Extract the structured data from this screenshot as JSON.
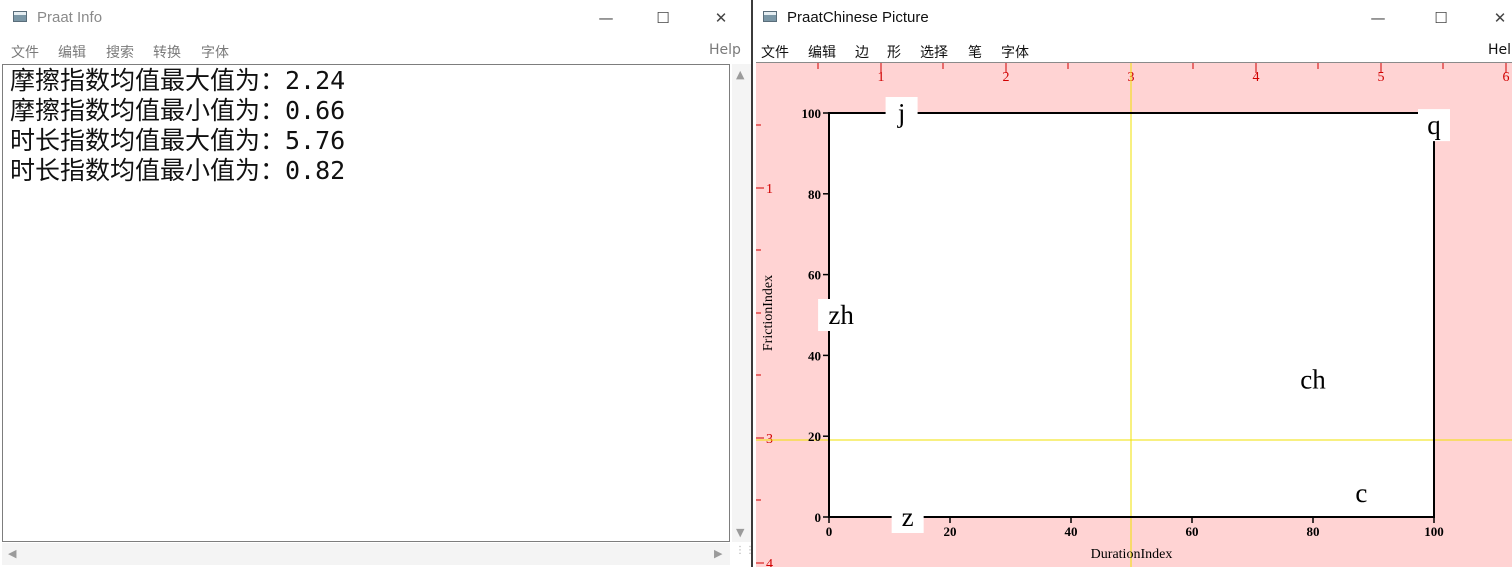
{
  "info_window": {
    "title": "Praat Info",
    "menu": [
      "文件",
      "编辑",
      "搜索",
      "转换",
      "字体"
    ],
    "help": "Help",
    "lines": [
      "摩擦指数均值最大值为：2.24",
      "摩擦指数均值最小值为：0.66",
      "时长指数均值最大值为：5.76",
      "时长指数均值最小值为：0.82"
    ]
  },
  "picture_window": {
    "title": "PraatChinese Picture",
    "menu": [
      "文件",
      "编辑",
      "边",
      "形",
      "选择",
      "笔",
      "字体"
    ],
    "help": "Hel",
    "ruler_top": [
      "1",
      "2",
      "3",
      "4",
      "5",
      "6"
    ],
    "ruler_left": [
      "1",
      "3",
      "4"
    ],
    "colors": {
      "canvas_bg": "#ffd3d3",
      "ruler": "#d10000",
      "selection": "#f2e200"
    }
  },
  "chart_data": {
    "type": "scatter",
    "title": "",
    "xlabel": "DurationIndex",
    "ylabel": "FrictionIndex",
    "xlim": [
      0,
      100
    ],
    "ylim": [
      0,
      100
    ],
    "xticks": [
      "0",
      "20",
      "40",
      "60",
      "80",
      "100"
    ],
    "yticks": [
      "0",
      "20",
      "40",
      "60",
      "80",
      "100"
    ],
    "points": [
      {
        "label": "j",
        "x": 12,
        "y": 100
      },
      {
        "label": "q",
        "x": 100,
        "y": 97
      },
      {
        "label": "zh",
        "x": 2,
        "y": 50
      },
      {
        "label": "ch",
        "x": 80,
        "y": 34
      },
      {
        "label": "c",
        "x": 88,
        "y": 6
      },
      {
        "label": "z",
        "x": 13,
        "y": 0
      }
    ]
  }
}
